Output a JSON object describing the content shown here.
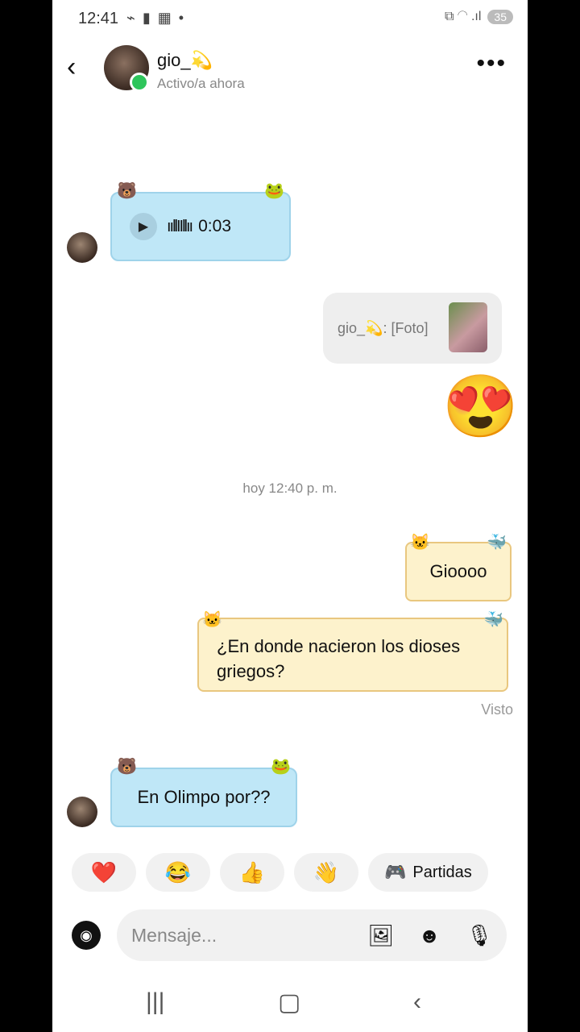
{
  "status_bar": {
    "time": "12:41",
    "left_icons": "⌁ ▮ ▦ •",
    "right_icons": "⧉ ◠ .ıl",
    "battery": "35"
  },
  "header": {
    "contact_name": "gio_💫",
    "contact_status": "Activo/a ahora",
    "back_icon": "‹",
    "more_icon": "•••"
  },
  "messages": {
    "voice_duration": "0:03",
    "voice_wave": "ııllIIllıı",
    "reply_preview": "gio_💫: [Foto]",
    "big_emoji": "😍",
    "timestamp": "hoy 12:40 p. m.",
    "out_1": "Gioooo",
    "out_2": "¿En donde nacieron los dioses griegos?",
    "seen_label": "Visto",
    "in_2": "En Olimpo por??"
  },
  "quick_reactions": {
    "heart": "❤️",
    "laugh": "😂",
    "thumbs_up": "👍",
    "wave": "👋",
    "games_label": "Partidas"
  },
  "composer": {
    "placeholder": "Mensaje..."
  },
  "colors": {
    "incoming_bubble": "#bfe7f7",
    "outgoing_bubble": "#fdf2cc",
    "online": "#2ec55b",
    "games_icon": "#3a5be0"
  }
}
